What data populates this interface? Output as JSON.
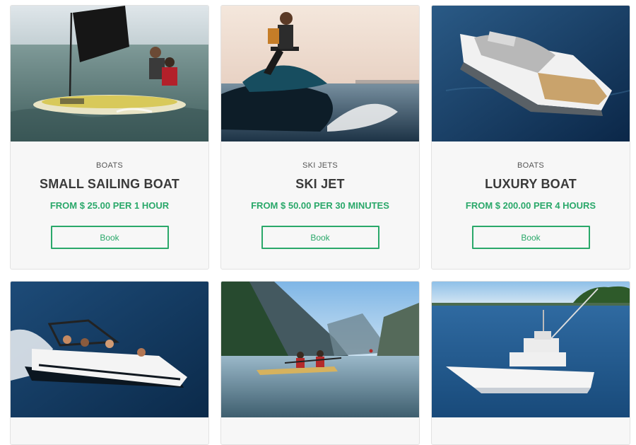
{
  "products": [
    {
      "category": "BOATS",
      "title": "SMALL SAILING BOAT",
      "price": "FROM $ 25.00 PER 1 HOUR",
      "button": "Book"
    },
    {
      "category": "SKI JETS",
      "title": "SKI JET",
      "price": "FROM $ 50.00 PER 30 MINUTES",
      "button": "Book"
    },
    {
      "category": "BOATS",
      "title": "LUXURY BOAT",
      "price": "FROM $ 200.00 PER 4 HOURS",
      "button": "Book"
    }
  ],
  "colors": {
    "accent": "#2aa86a",
    "title": "#3a3a3a",
    "card_bg": "#f7f7f7"
  }
}
